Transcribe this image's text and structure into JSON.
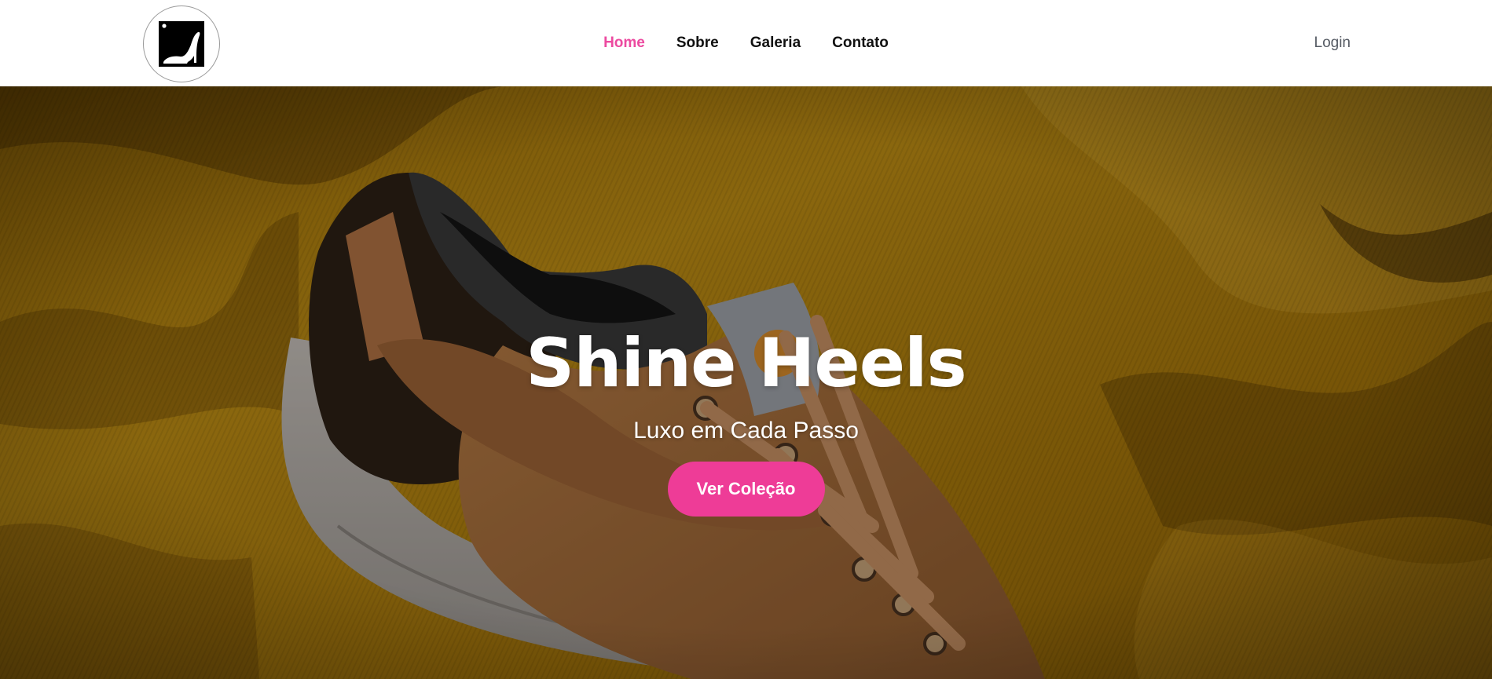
{
  "header": {
    "logo_alt": "Shine Heels logo",
    "nav": [
      {
        "label": "Home",
        "active": true
      },
      {
        "label": "Sobre",
        "active": false
      },
      {
        "label": "Galeria",
        "active": false
      },
      {
        "label": "Contato",
        "active": false
      }
    ],
    "login_label": "Login"
  },
  "hero": {
    "title": "Shine Heels",
    "subtitle": "Luxo em Cada Passo",
    "cta_label": "Ver Coleção",
    "image_subject": "brown canvas sneaker on mustard-yellow corduroy fabric"
  },
  "colors": {
    "accent": "#ec4aa0",
    "cta_bg": "#ee3c97",
    "nav_text": "#111111",
    "login_text": "#555a63",
    "hero_fabric": "#b8860f"
  },
  "icons": {
    "logo": "high-heel-icon"
  }
}
